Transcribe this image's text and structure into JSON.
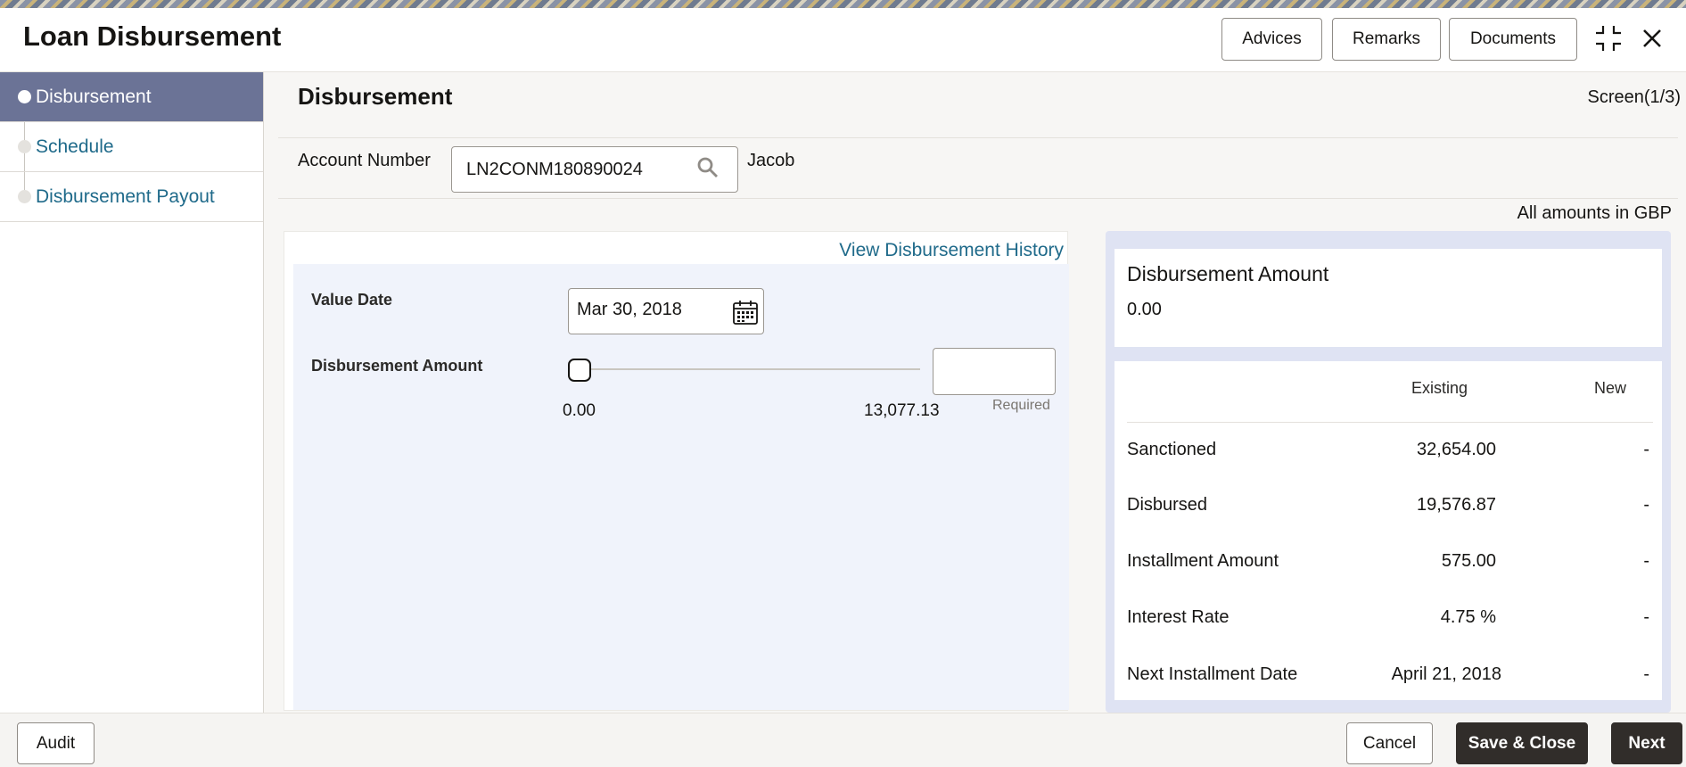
{
  "window": {
    "title": "Loan Disbursement",
    "buttons": {
      "advices": "Advices",
      "remarks": "Remarks",
      "documents": "Documents"
    }
  },
  "sidebar": {
    "items": [
      {
        "label": "Disbursement",
        "active": true
      },
      {
        "label": "Schedule",
        "active": false
      },
      {
        "label": "Disbursement Payout",
        "active": false
      }
    ]
  },
  "main": {
    "section_title": "Disbursement",
    "screen_indicator": "Screen(1/3)",
    "account": {
      "label": "Account Number",
      "value": "LN2CONM180890024",
      "name": "Jacob"
    },
    "amounts_note": "All amounts in GBP",
    "history_link": "View Disbursement History",
    "form": {
      "value_date_label": "Value Date",
      "value_date": "Mar 30, 2018",
      "amount_label": "Disbursement Amount",
      "slider_min": "0.00",
      "slider_max": "13,077.13",
      "slider_level": 0,
      "amount_value": "",
      "required_hint": "Required"
    },
    "summary": {
      "title": "Disbursement Amount",
      "value": "0.00",
      "col_existing": "Existing",
      "col_new": "New",
      "rows": [
        {
          "label": "Sanctioned",
          "existing": "32,654.00",
          "new": "-"
        },
        {
          "label": "Disbursed",
          "existing": "19,576.87",
          "new": "-"
        },
        {
          "label": "Installment Amount",
          "existing": "575.00",
          "new": "-"
        },
        {
          "label": "Interest Rate",
          "existing": "4.75 %",
          "new": "-"
        },
        {
          "label": "Next Installment Date",
          "existing": "April 21, 2018",
          "new": "-"
        }
      ]
    }
  },
  "footer": {
    "audit": "Audit",
    "cancel": "Cancel",
    "save_close": "Save & Close",
    "next": "Next"
  },
  "colors": {
    "nav_active": "#6b7396",
    "link": "#1f6a8a",
    "primary_button": "#312d2a",
    "summary_panel": "#dfe3f3",
    "form_bg": "#f0f3fb"
  }
}
